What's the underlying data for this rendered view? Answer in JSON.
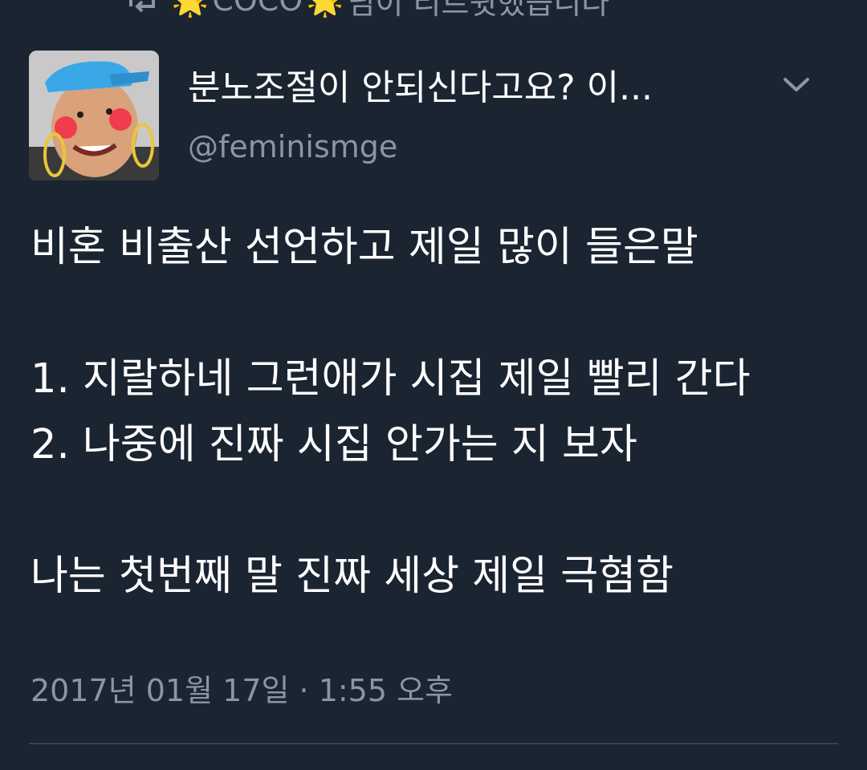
{
  "retweet": {
    "icon": "retweet-icon",
    "star_left": "🌟",
    "retweeter": "COCO",
    "star_right": "🌟",
    "suffix": "님이 리트윗했습니다"
  },
  "tweet": {
    "author_name": "분노조절이 안되신다고요? 이...",
    "author_handle": "@feminismge",
    "body": "비혼 비출산 선언하고 제일 많이 들은말\n\n1. 지랄하네 그런애가 시집 제일 빨리 간다\n2. 나중에 진짜 시집 안가는 지 보자\n\n나는 첫번째 말 진짜 세상 제일 극혐함",
    "timestamp": "2017년 01월 17일 · 1:55 오후"
  },
  "colors": {
    "background": "#1b2431",
    "text_primary": "#ffffff",
    "text_secondary": "#8a96a3",
    "divider": "#38444d",
    "star": "#f5b81e"
  },
  "icons": {
    "menu": "chevron-down-icon",
    "avatar": "avatar"
  }
}
